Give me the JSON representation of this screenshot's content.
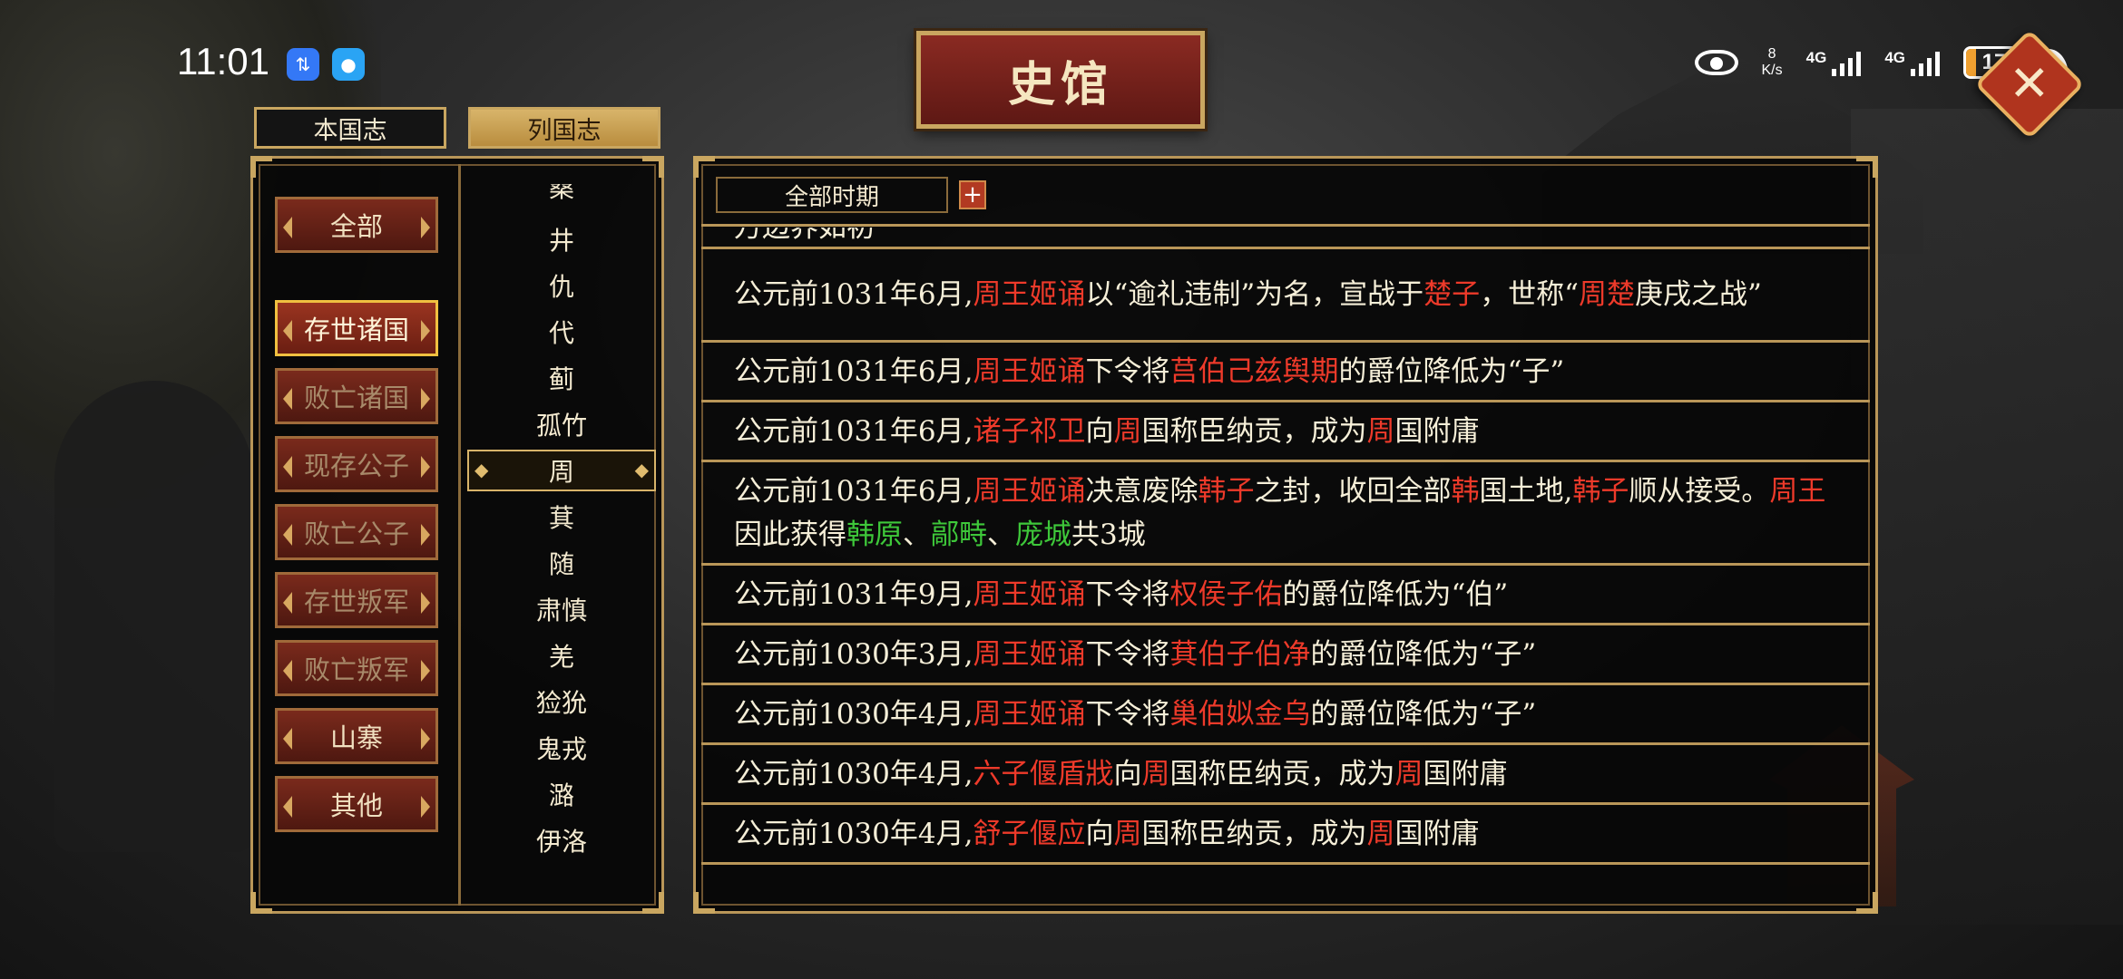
{
  "status_bar": {
    "time": "11:01",
    "net_speed_value": "8",
    "net_speed_unit": "K/s",
    "signal1_label": "4G",
    "signal2_label": "4G",
    "battery": "17",
    "icons": [
      "app-icon-transfer",
      "app-icon-message",
      "eye-icon",
      "signal-icon",
      "battery-icon",
      "leaf-icon"
    ]
  },
  "header": {
    "title": "史馆",
    "close_glyph": "✕"
  },
  "top_tabs": [
    {
      "label": "本国志",
      "active": false
    },
    {
      "label": "列国志",
      "active": true
    }
  ],
  "categories": [
    {
      "label": "全部",
      "selected": false
    },
    {
      "label": "存世诸国",
      "selected": true
    },
    {
      "label": "败亡诸国",
      "selected": false
    },
    {
      "label": "现存公子",
      "selected": false
    },
    {
      "label": "败亡公子",
      "selected": false
    },
    {
      "label": "存世叛军",
      "selected": false
    },
    {
      "label": "败亡叛军",
      "selected": false
    },
    {
      "label": "山寨",
      "selected": false
    },
    {
      "label": "其他",
      "selected": false
    }
  ],
  "nations": [
    "桑",
    "井",
    "仇",
    "代",
    "蓟",
    "孤竹",
    "周",
    "萁",
    "随",
    "肃慎",
    "羌",
    "猃狁",
    "鬼戎",
    "潞",
    "伊洛"
  ],
  "selected_nation": "周",
  "filter": {
    "period": "全部时期",
    "plus": "+"
  },
  "log": {
    "partial_top": "万边界如初",
    "entries": [
      {
        "segments": [
          [
            "公元前1031年6月,",
            ""
          ],
          [
            "周王姬诵",
            "r"
          ],
          [
            "以“逾礼违制”为名，宣战于",
            ""
          ],
          [
            "楚子",
            "r"
          ],
          [
            "，世称“",
            ""
          ],
          [
            "周楚",
            "r"
          ],
          [
            "庚戌之战”",
            ""
          ]
        ]
      },
      {
        "segments": [
          [
            "公元前1031年6月,",
            ""
          ],
          [
            "周王姬诵",
            "r"
          ],
          [
            "下令将",
            ""
          ],
          [
            "莒伯己兹舆期",
            "r"
          ],
          [
            "的爵位降低为“子”",
            ""
          ]
        ]
      },
      {
        "segments": [
          [
            "公元前1031年6月,",
            ""
          ],
          [
            "诸子祁卫",
            "r"
          ],
          [
            "向",
            ""
          ],
          [
            "周",
            "r"
          ],
          [
            "国称臣纳贡，成为",
            ""
          ],
          [
            "周",
            "r"
          ],
          [
            "国附庸",
            ""
          ]
        ]
      },
      {
        "segments": [
          [
            "公元前1031年6月,",
            ""
          ],
          [
            "周王姬诵",
            "r"
          ],
          [
            "决意废除",
            ""
          ],
          [
            "韩子",
            "r"
          ],
          [
            "之封，收回全部",
            ""
          ],
          [
            "韩",
            "r"
          ],
          [
            "国土地,",
            ""
          ],
          [
            "韩子",
            "r"
          ],
          [
            "顺从接受。",
            ""
          ],
          [
            "周王",
            "r"
          ],
          [
            "因此获得",
            ""
          ],
          [
            "韩原",
            "g"
          ],
          [
            "、",
            ""
          ],
          [
            "鄗畤",
            "g"
          ],
          [
            "、",
            ""
          ],
          [
            "庞城",
            "g"
          ],
          [
            "共3城",
            ""
          ]
        ]
      },
      {
        "segments": [
          [
            "公元前1031年9月,",
            ""
          ],
          [
            "周王姬诵",
            "r"
          ],
          [
            "下令将",
            ""
          ],
          [
            "权侯子佑",
            "r"
          ],
          [
            "的爵位降低为“伯”",
            ""
          ]
        ]
      },
      {
        "segments": [
          [
            "公元前1030年3月,",
            ""
          ],
          [
            "周王姬诵",
            "r"
          ],
          [
            "下令将",
            ""
          ],
          [
            "萁伯子伯净",
            "r"
          ],
          [
            "的爵位降低为“子”",
            ""
          ]
        ]
      },
      {
        "segments": [
          [
            "公元前1030年4月,",
            ""
          ],
          [
            "周王姬诵",
            "r"
          ],
          [
            "下令将",
            ""
          ],
          [
            "巢伯姒金乌",
            "r"
          ],
          [
            "的爵位降低为“子”",
            ""
          ]
        ]
      },
      {
        "segments": [
          [
            "公元前1030年4月,",
            ""
          ],
          [
            "六子偃盾戕",
            "r"
          ],
          [
            "向",
            ""
          ],
          [
            "周",
            "r"
          ],
          [
            "国称臣纳贡，成为",
            ""
          ],
          [
            "周",
            "r"
          ],
          [
            "国附庸",
            ""
          ]
        ]
      },
      {
        "segments": [
          [
            "公元前1030年4月,",
            ""
          ],
          [
            "舒子偃应",
            "r"
          ],
          [
            "向",
            ""
          ],
          [
            "周",
            "r"
          ],
          [
            "国称臣纳贡，成为",
            ""
          ],
          [
            "周",
            "r"
          ],
          [
            "国附庸",
            ""
          ]
        ]
      }
    ]
  }
}
